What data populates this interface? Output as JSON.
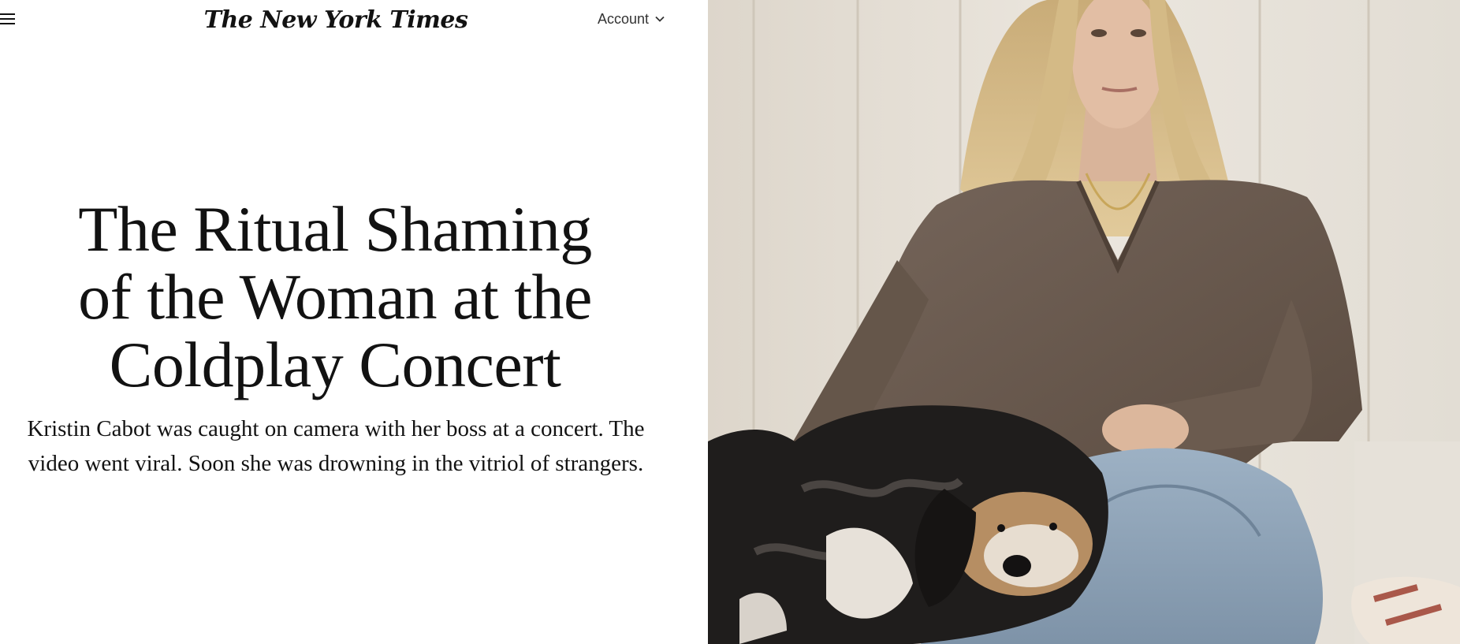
{
  "header": {
    "logo_text": "The New York Times",
    "account_label": "Account",
    "menu_icon": "hamburger-menu-icon",
    "account_icon": "chevron-down-icon"
  },
  "article": {
    "headline": "The Ritual Shaming of the Woman at the Coldplay Concert",
    "dek": "Kristin Cabot was caught on camera with her boss at a concert. The video went viral. Soon she was drowning in the vitriol of strangers."
  },
  "colors": {
    "text": "#121212",
    "background": "#ffffff",
    "wall": "#e9e4dc",
    "sweater": "#6a5a4d",
    "jeans": "#8fa3b8",
    "dog_dark": "#1f1d1c",
    "hair": "#d8c08e"
  }
}
